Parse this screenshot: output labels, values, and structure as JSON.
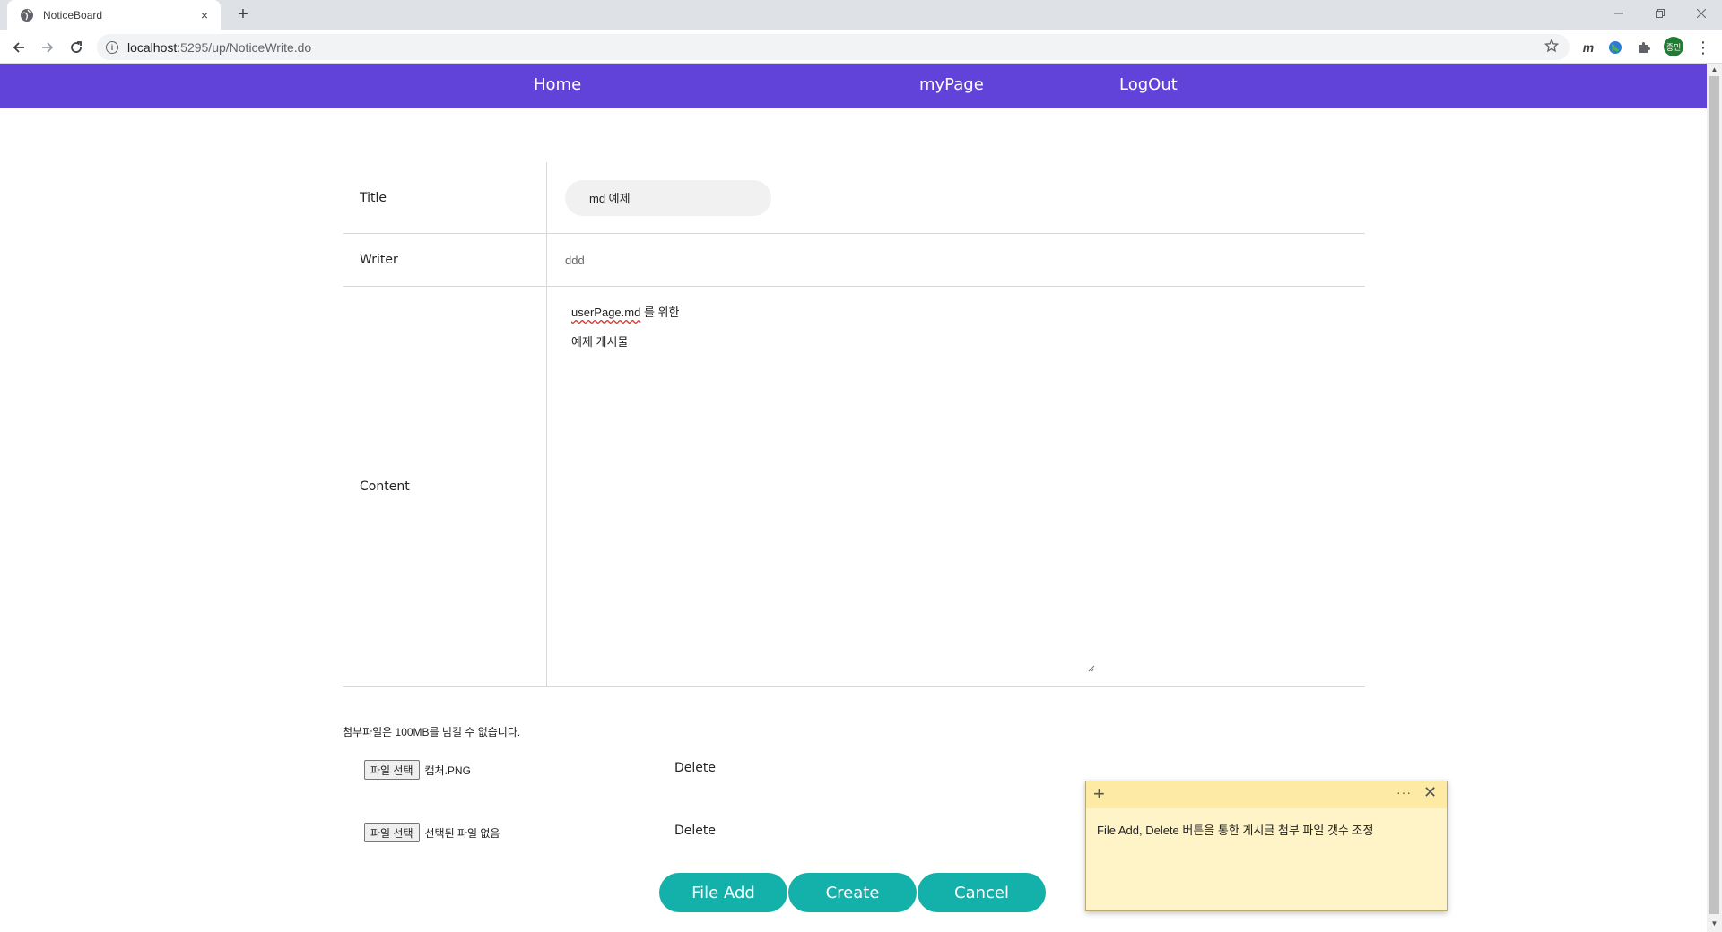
{
  "browser": {
    "tab_title": "NoticeBoard",
    "tab_close": "×",
    "new_tab": "+",
    "url_host": "localhost",
    "url_path": ":5295/up/NoticeWrite.do",
    "avatar_text": "종민",
    "window_controls": [
      "minimize",
      "restore",
      "close"
    ]
  },
  "navbar": {
    "home": "Home",
    "mypage": "myPage",
    "logout": "LogOut",
    "color": "#6243d9"
  },
  "form": {
    "title_label": "Title",
    "title_value": "md 예제",
    "writer_label": "Writer",
    "writer_value": "ddd",
    "content_label": "Content",
    "content_line1_spell": "userPage.md",
    "content_line1_rest": " 를 위한",
    "content_line2": "예제 게시물"
  },
  "attachments": {
    "limit_notice": "첨부파일은 100MB를 넘길 수 없습니다.",
    "rows": [
      {
        "button": "파일 선택",
        "file": "캡처.PNG",
        "delete": "Delete"
      },
      {
        "button": "파일 선택",
        "file": "선택된 파일 없음",
        "delete": "Delete"
      }
    ]
  },
  "actions": {
    "file_add": "File Add",
    "create": "Create",
    "cancel": "Cancel",
    "color": "#14b1ab"
  },
  "sticky_note": {
    "add": "+",
    "more": "···",
    "close": "✕",
    "text": "File Add, Delete 버튼을 통한 게시글 첨부 파일 갯수 조정"
  }
}
